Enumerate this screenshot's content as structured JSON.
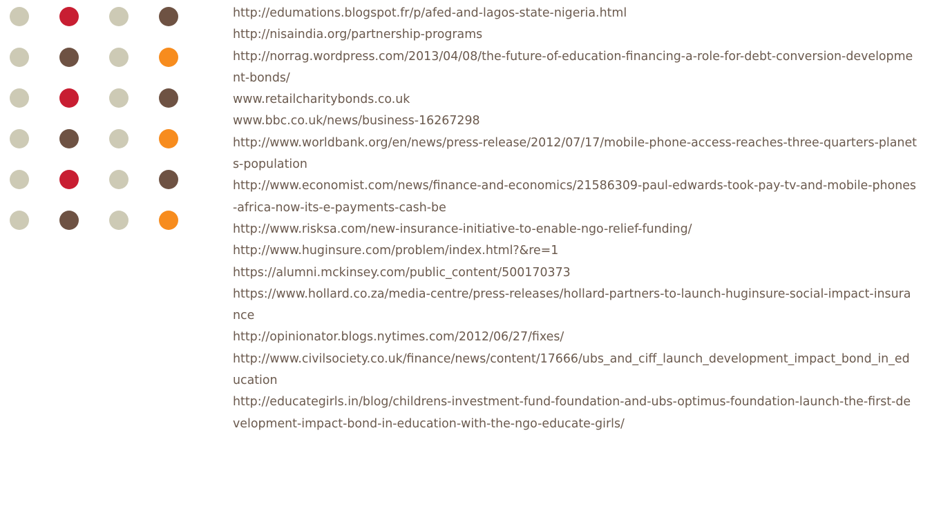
{
  "colors": {
    "dot_beige": "#cdcab5",
    "dot_red": "#c81e32",
    "dot_brown": "#6e5243",
    "dot_orange": "#f78c1e",
    "text": "#6b5a4e"
  },
  "dot_rows": [
    [
      "beige",
      "red",
      "beige",
      "brown"
    ],
    [
      "beige",
      "brown",
      "beige",
      "orange"
    ],
    [
      "beige",
      "red",
      "beige",
      "brown"
    ],
    [
      "beige",
      "brown",
      "beige",
      "orange"
    ],
    [
      "beige",
      "red",
      "beige",
      "brown"
    ],
    [
      "beige",
      "brown",
      "beige",
      "orange"
    ]
  ],
  "references": [
    "http://edumations.blogspot.fr/p/afed-and-lagos-state-nigeria.html",
    "http://nisaindia.org/partnership-programs",
    "http://norrag.wordpress.com/2013/04/08/the-future-of-education-financing-a-role-for-debt-conversion-development-bonds/",
    "www.retailcharitybonds.co.uk",
    "www.bbc.co.uk/news/business-16267298",
    "http://www.worldbank.org/en/news/press-release/2012/07/17/mobile-phone-access-reaches-three-quarters-planets-population",
    "http://www.economist.com/news/finance-and-economics/21586309-paul-edwards-took-pay-tv-and-mobile-phones-africa-now-its-e-payments-cash-be",
    "http://www.risksa.com/new-insurance-initiative-to-enable-ngo-relief-funding/",
    "http://www.huginsure.com/problem/index.html?&re=1",
    "https://alumni.mckinsey.com/public_content/500170373",
    "https://www.hollard.co.za/media-centre/press-releases/hollard-partners-to-launch-huginsure-social-impact-insurance",
    "http://opinionator.blogs.nytimes.com/2012/06/27/fixes/",
    "http://www.civilsociety.co.uk/finance/news/content/17666/ubs_and_ciff_launch_development_impact_bond_in_education",
    "http://educategirls.in/blog/childrens-investment-fund-foundation-and-ubs-optimus-foundation-launch-the-first-development-impact-bond-in-education-with-the-ngo-educate-girls/"
  ]
}
